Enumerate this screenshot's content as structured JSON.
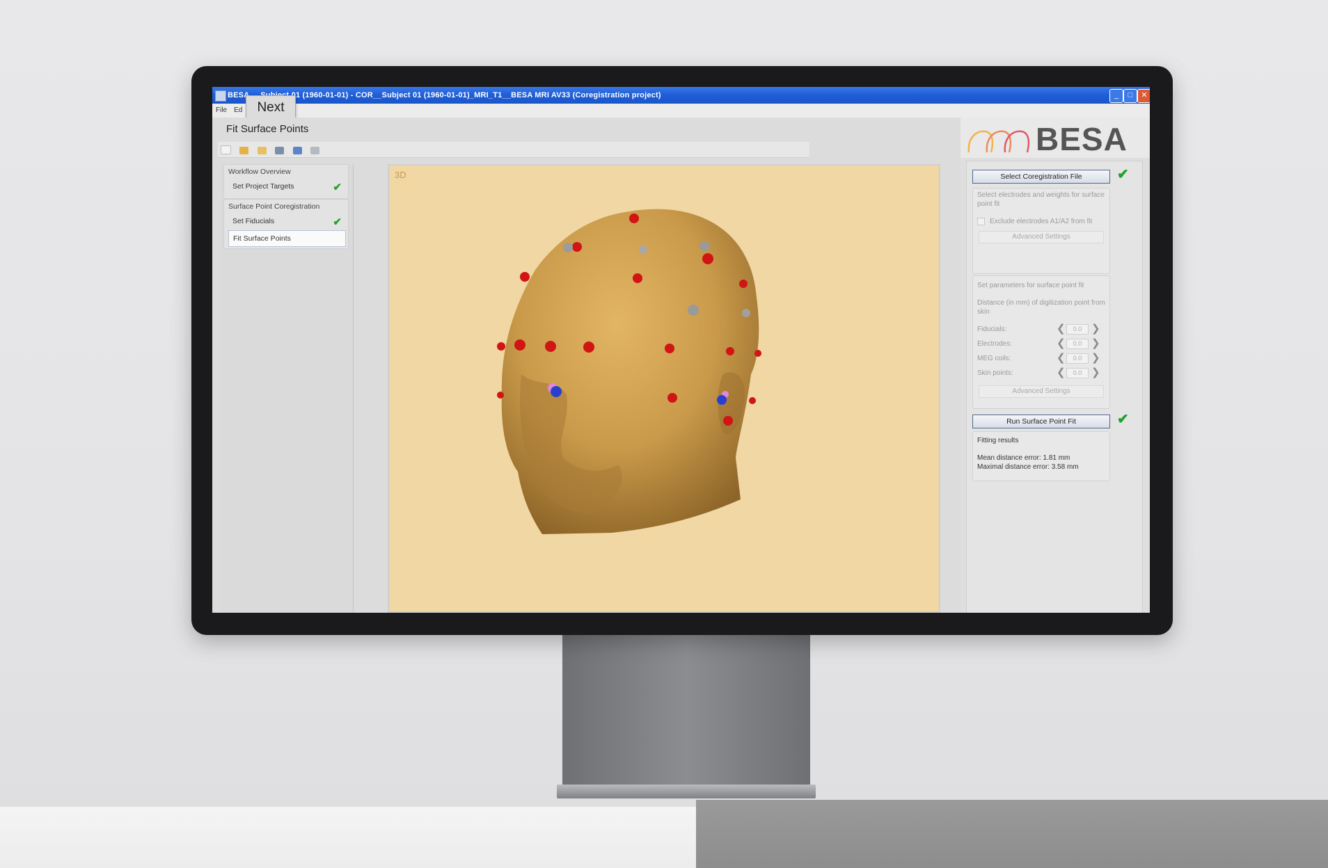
{
  "window": {
    "title": "BESA ... Subject 01 (1960-01-01) - COR__Subject 01 (1960-01-01)_MRI_T1__BESA MRI AV33 (Coregistration project)"
  },
  "menu": {
    "file": "File",
    "edit": "Ed"
  },
  "tooltip": {
    "next": "Next"
  },
  "page": {
    "title": "Fit Surface Points"
  },
  "workflow": {
    "group1_title": "Workflow Overview",
    "set_project_targets": "Set Project Targets",
    "group2_title": "Surface Point Coregistration",
    "set_fiducials": "Set Fiducials",
    "fit_surface_points": "Fit Surface Points"
  },
  "view": {
    "label": "3D"
  },
  "brand": {
    "name": "BESA"
  },
  "right_panel": {
    "select_file_button": "Select Coregistration File",
    "select_electrodes_text": "Select electrodes and weights for surface point fit",
    "exclude_checkbox_label": "Exclude electrodes A1/A2 from fit",
    "advanced_settings_1": "Advanced Settings",
    "set_params_text": "Set parameters for surface point fit",
    "distance_text": "Distance (in mm) of digitization point from skin",
    "params": [
      {
        "label": "Fiducials:",
        "value": "0.0"
      },
      {
        "label": "Electrodes:",
        "value": "0.0"
      },
      {
        "label": "MEG coils:",
        "value": "0.0"
      },
      {
        "label": "Skin points:",
        "value": "0.0"
      }
    ],
    "advanced_settings_2": "Advanced Settings",
    "run_fit_button": "Run Surface Point Fit",
    "fitting_results_title": "Fitting results",
    "mean_error": "Mean distance error: 1.81 mm",
    "max_error": "Maximal distance error: 3.58 mm"
  },
  "colors": {
    "titlebar": "#1f5fd8",
    "view_background": "#f0d7a4",
    "head": "#c99a4a",
    "electrode": "#d11414",
    "fiducial": "#2a3fd0",
    "check": "#1fa12c"
  }
}
